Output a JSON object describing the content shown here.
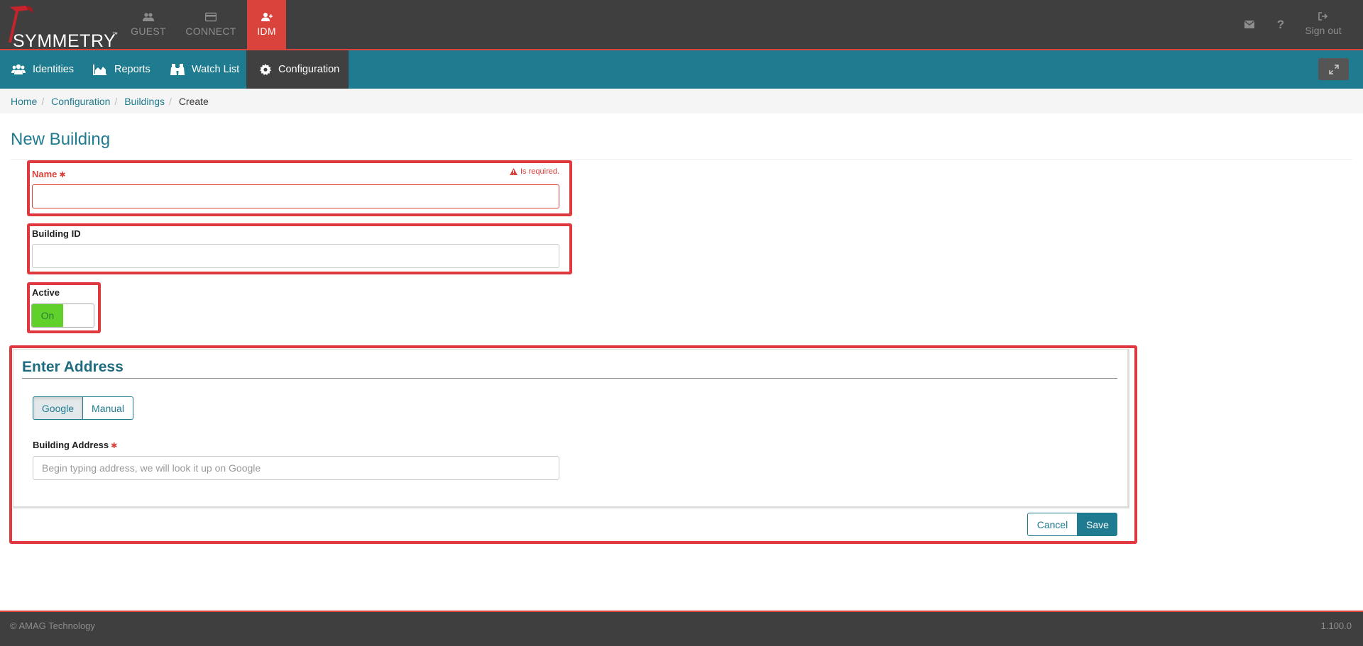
{
  "app": {
    "logo_text": "SYMMETRY",
    "logo_tm": "™",
    "tabs": [
      {
        "label": "GUEST",
        "icon": "users-icon",
        "active": false
      },
      {
        "label": "CONNECT",
        "icon": "credit-card-icon",
        "active": false
      },
      {
        "label": "IDM",
        "icon": "user-plus-icon",
        "active": true
      }
    ],
    "right": {
      "mail_icon": "envelope-icon",
      "help_label": "?",
      "signout_label": "Sign out"
    }
  },
  "nav": {
    "items": [
      {
        "label": "Identities",
        "icon": "users-icon"
      },
      {
        "label": "Reports",
        "icon": "area-chart-icon"
      },
      {
        "label": "Watch List",
        "icon": "binoculars-icon"
      },
      {
        "label": "Configuration",
        "icon": "gear-icon",
        "active": true
      }
    ]
  },
  "breadcrumb": {
    "items": [
      "Home",
      "Configuration",
      "Buildings"
    ],
    "current": "Create"
  },
  "page": {
    "title": "New Building"
  },
  "form": {
    "name": {
      "label": "Name",
      "required_mark": "✱",
      "error": "Is required.",
      "value": ""
    },
    "building_id": {
      "label": "Building ID",
      "value": ""
    },
    "active": {
      "label": "Active",
      "state": "On"
    }
  },
  "address": {
    "title": "Enter Address",
    "modes": [
      "Google",
      "Manual"
    ],
    "selected_mode": "Google",
    "field_label": "Building Address",
    "required_mark": "✱",
    "placeholder": "Begin typing address, we will look it up on Google",
    "value": ""
  },
  "actions": {
    "cancel": "Cancel",
    "save": "Save"
  },
  "footer": {
    "copyright": "© AMAG Technology",
    "version": "1.100.0"
  },
  "colors": {
    "accent_red": "#d9433b",
    "teal": "#1f7b8f",
    "dark_bar": "#3f3f3f",
    "toggle_green": "#5fd12a"
  }
}
